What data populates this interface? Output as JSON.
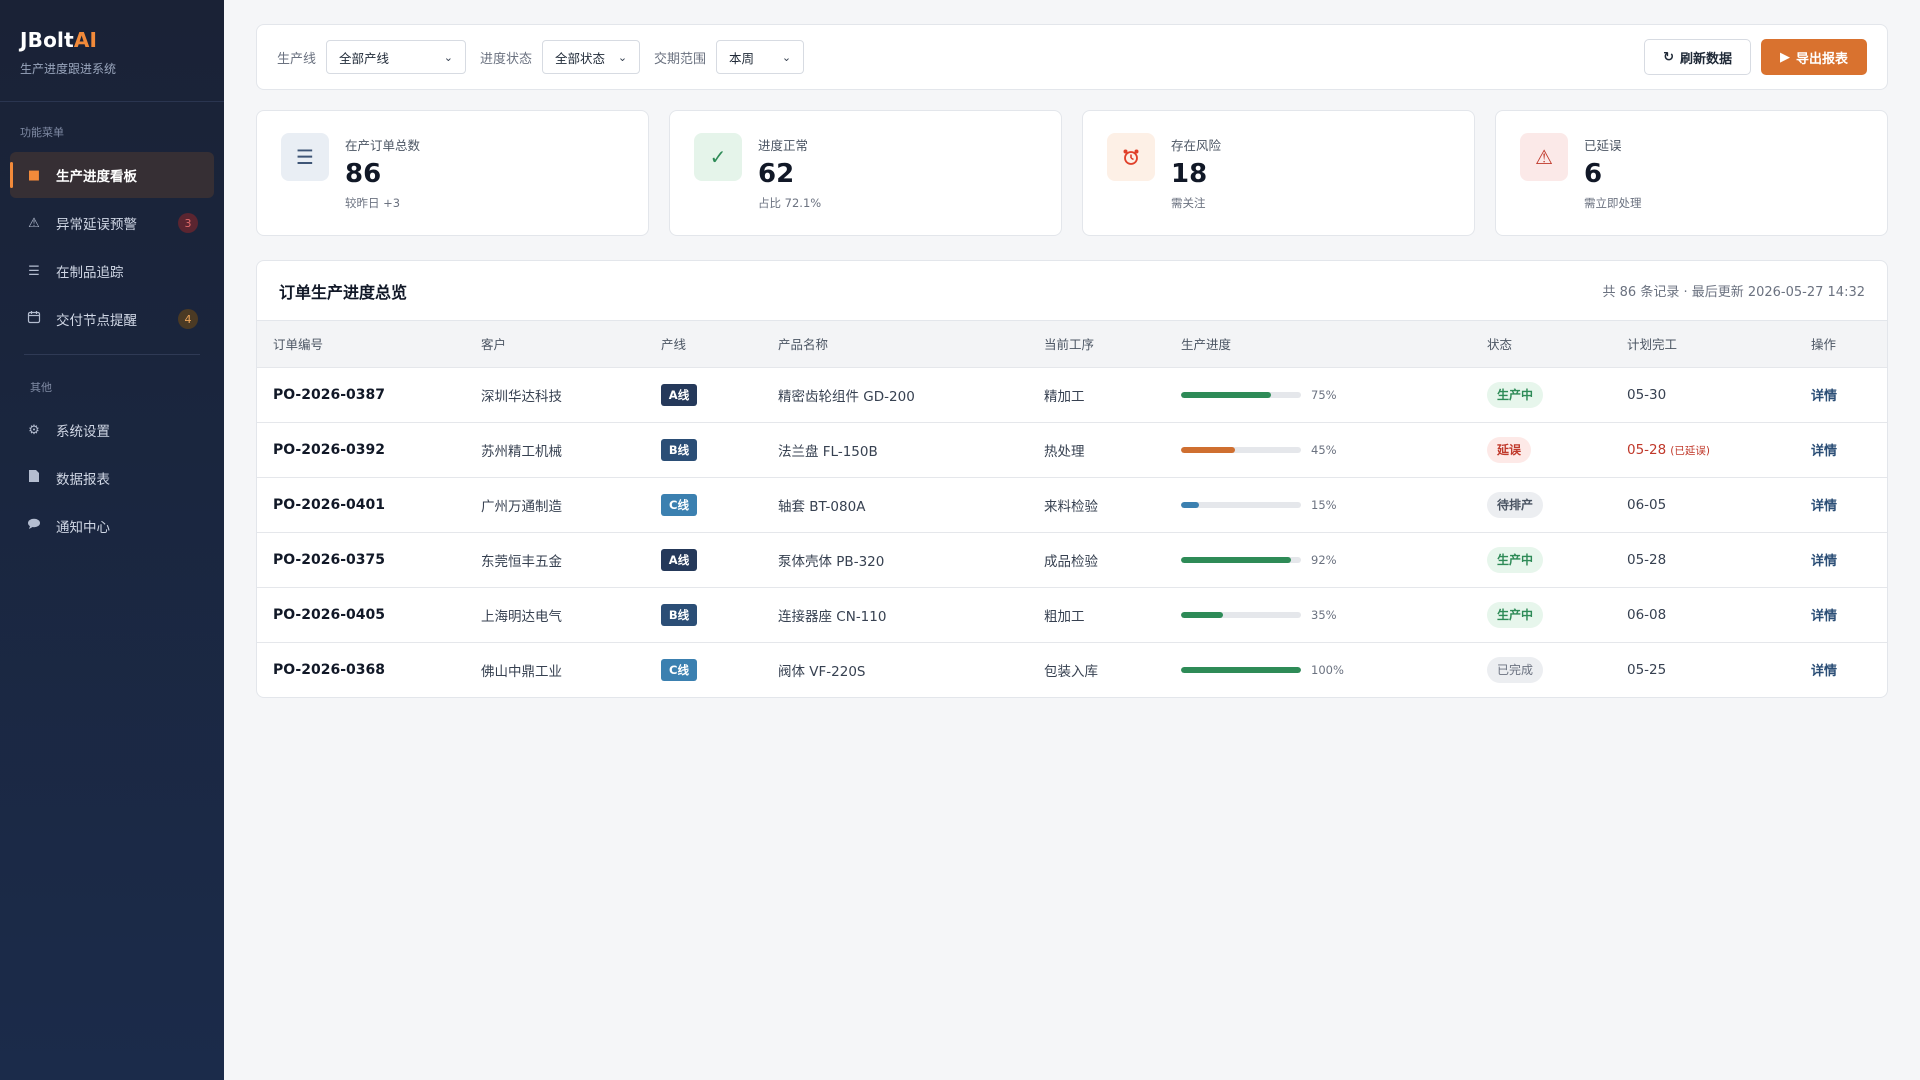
{
  "brand": {
    "name": "JBolt",
    "accent": "AI",
    "subtitle": "生产进度跟进系统"
  },
  "sidebar": {
    "section1": "功能菜单",
    "items": [
      {
        "label": "生产进度看板",
        "icon": "square-icon",
        "active": true,
        "badge": ""
      },
      {
        "label": "异常延误预警",
        "icon": "warning-icon",
        "active": false,
        "badge": "3"
      },
      {
        "label": "在制品追踪",
        "icon": "list-icon",
        "active": false,
        "badge": ""
      },
      {
        "label": "交付节点提醒",
        "icon": "calendar-icon",
        "active": false,
        "badge": "4"
      }
    ],
    "section2": "其他",
    "items2": [
      {
        "label": "系统设置",
        "icon": "gear-icon"
      },
      {
        "label": "数据报表",
        "icon": "document-icon"
      },
      {
        "label": "通知中心",
        "icon": "chat-icon"
      }
    ]
  },
  "filters": {
    "line_label": "生产线",
    "line_value": "全部产线",
    "status_label": "进度状态",
    "status_value": "全部状态",
    "range_label": "交期范围",
    "range_value": "本周",
    "refresh_label": "刷新数据",
    "export_label": "导出报表"
  },
  "kpis": [
    {
      "label": "在产订单总数",
      "value": "86",
      "sub": "较昨日 +3",
      "icon": "list-icon"
    },
    {
      "label": "进度正常",
      "value": "62",
      "sub": "占比 72.1%",
      "icon": "check-icon"
    },
    {
      "label": "存在风险",
      "value": "18",
      "sub": "需关注",
      "icon": "alarm-clock-icon"
    },
    {
      "label": "已延误",
      "value": "6",
      "sub": "需立即处理",
      "icon": "warning-icon"
    }
  ],
  "table": {
    "title": "订单生产进度总览",
    "meta": "共 86 条记录 · 最后更新 2026-05-27 14:32",
    "columns": [
      "订单编号",
      "客户",
      "产线",
      "产品名称",
      "当前工序",
      "生产进度",
      "状态",
      "计划完工",
      "操作"
    ],
    "rows": [
      {
        "order": "PO-2026-0387",
        "customer": "深圳华达科技",
        "line": "A线",
        "product": "精密齿轮组件 GD-200",
        "process": "精加工",
        "progress": 75,
        "progress_text": "75%",
        "status": "生产中",
        "due": "05-30",
        "due_note": "",
        "action": "详情"
      },
      {
        "order": "PO-2026-0392",
        "customer": "苏州精工机械",
        "line": "B线",
        "product": "法兰盘 FL-150B",
        "process": "热处理",
        "progress": 45,
        "progress_text": "45%",
        "status": "延误",
        "due": "05-28",
        "due_note": "(已延误)",
        "action": "详情"
      },
      {
        "order": "PO-2026-0401",
        "customer": "广州万通制造",
        "line": "C线",
        "product": "轴套 BT-080A",
        "process": "来料检验",
        "progress": 15,
        "progress_text": "15%",
        "status": "待排产",
        "due": "06-05",
        "due_note": "",
        "action": "详情"
      },
      {
        "order": "PO-2026-0375",
        "customer": "东莞恒丰五金",
        "line": "A线",
        "product": "泵体壳体 PB-320",
        "process": "成品检验",
        "progress": 92,
        "progress_text": "92%",
        "status": "生产中",
        "due": "05-28",
        "due_note": "",
        "action": "详情"
      },
      {
        "order": "PO-2026-0405",
        "customer": "上海明达电气",
        "line": "B线",
        "product": "连接器座 CN-110",
        "process": "粗加工",
        "progress": 35,
        "progress_text": "35%",
        "status": "生产中",
        "due": "06-08",
        "due_note": "",
        "action": "详情"
      },
      {
        "order": "PO-2026-0368",
        "customer": "佛山中鼎工业",
        "line": "C线",
        "product": "阀体 VF-220S",
        "process": "包装入库",
        "progress": 100,
        "progress_text": "100%",
        "status": "已完成",
        "due": "05-25",
        "due_note": "",
        "action": "详情"
      }
    ]
  },
  "colors": {
    "accent": "#d9722f",
    "progress_green": "#2e8b57",
    "progress_orange": "#cf6f30",
    "progress_blue": "#3b80b0"
  }
}
